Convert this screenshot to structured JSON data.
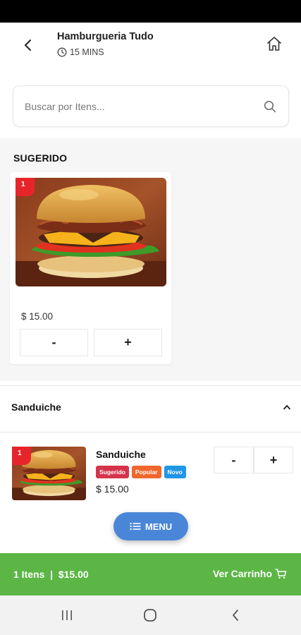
{
  "header": {
    "title": "Hamburgueria Tudo",
    "delivery_time": "15 MINS"
  },
  "search": {
    "placeholder": "Buscar por Itens..."
  },
  "suggested": {
    "section_title": "SUGERIDO",
    "items": [
      {
        "image": "burger-photo",
        "quantity": "1",
        "price": "$ 15.00",
        "minus_label": "-",
        "plus_label": "+"
      }
    ]
  },
  "categories": [
    {
      "title": "Sanduiche",
      "expanded": true,
      "items": [
        {
          "name": "Sanduiche",
          "image": "burger-photo",
          "quantity": "1",
          "tags": [
            {
              "label": "Sugerido",
              "color": "#d6334b"
            },
            {
              "label": "Popular",
              "color": "#f0672c"
            },
            {
              "label": "Novo",
              "color": "#2196e6"
            }
          ],
          "price": "$ 15.00",
          "minus_label": "-",
          "plus_label": "+"
        }
      ]
    }
  ],
  "menu_button": {
    "label": "MENU",
    "color": "#4a86d8"
  },
  "cart_bar": {
    "summary": "1 Itens  |  $15.00",
    "link_label": "Ver Carrinho",
    "color": "#5cb646"
  },
  "colors": {
    "badge": "#e6252a",
    "page_background": "#f6f6f6"
  },
  "system_nav": [
    "recent-apps-icon",
    "home-circle-icon",
    "back-chevron-icon"
  ]
}
